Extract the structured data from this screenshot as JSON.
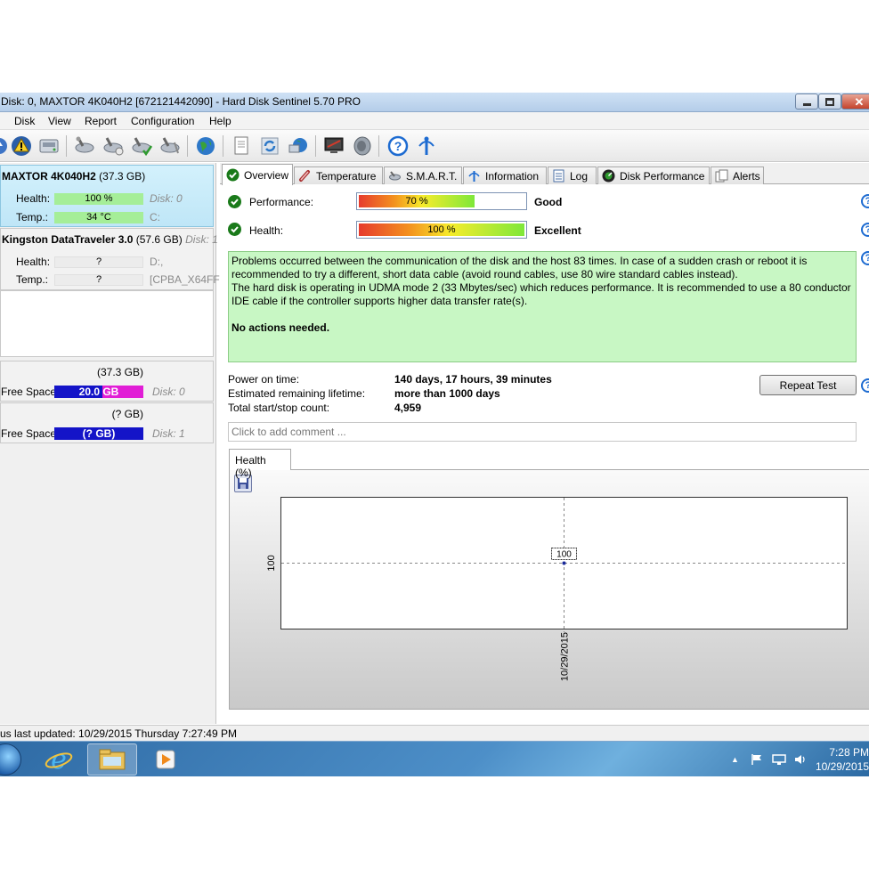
{
  "window": {
    "title": "Disk: 0, MAXTOR 4K040H2 [672121442090]  -  Hard Disk Sentinel 5.70 PRO",
    "close_glyph": "✕"
  },
  "menu": [
    "Disk",
    "View",
    "Report",
    "Configuration",
    "Help"
  ],
  "toolbar": {
    "icons": [
      "refresh-icon",
      "alert-icon",
      "disk-icon",
      "test-icon",
      "test2-icon",
      "test3-icon",
      "test4-icon",
      "web-icon",
      "report-icon",
      "sync-icon",
      "network-icon",
      "monitor-icon",
      "sound-icon",
      "help-icon",
      "info-icon"
    ]
  },
  "disks": [
    {
      "name": "MAXTOR 4K040H2",
      "size": "(37.3 GB)",
      "disk_no": "",
      "health_label": "Health:",
      "health": "100 %",
      "health_meta": "Disk: 0",
      "temp_label": "Temp.:",
      "temp": "34 °C",
      "temp_meta": "C:"
    },
    {
      "name": "Kingston DataTraveler 3.0",
      "size": "(57.6 GB)",
      "disk_no": "Disk: 1",
      "health_label": "Health:",
      "health": "?",
      "health_meta": "D:,",
      "temp_label": "Temp.:",
      "temp": "?",
      "temp_meta": "[CPBA_X64FF"
    }
  ],
  "volumes": [
    {
      "size": "(37.3 GB)",
      "label": "Free Space",
      "free": "20.0 GB",
      "used_fraction": 0.46,
      "disk": "Disk: 0"
    },
    {
      "size": "(? GB)",
      "label": "Free Space",
      "free": "(? GB)",
      "used_fraction": 0,
      "disk": "Disk: 1"
    }
  ],
  "tabs": [
    "Overview",
    "Temperature",
    "S.M.A.R.T.",
    "Information",
    "Log",
    "Disk Performance",
    "Alerts"
  ],
  "overview": {
    "performance_label": "Performance:",
    "performance_value": "70 %",
    "performance_fraction": 0.7,
    "performance_word": "Good",
    "health_label": "Health:",
    "health_value": "100 %",
    "health_fraction": 1.0,
    "health_word": "Excellent",
    "help_glyph": "?",
    "message_p1": "Problems occurred between the communication of the disk and the host 83 times. In case of a sudden crash or reboot it is recommended to try a different, short data cable (avoid round cables, use 80 wire standard cables instead).",
    "message_p2": "The hard disk is operating in UDMA mode 2 (33 Mbytes/sec) which reduces performance. It is recommended to use a 80 conductor IDE cable if the controller supports higher data transfer rate(s).",
    "message_bold": "No actions needed.",
    "power_on_label": "Power on time:",
    "power_on_value": "140 days, 17 hours, 39 minutes",
    "lifetime_label": "Estimated remaining lifetime:",
    "lifetime_value": "more than 1000 days",
    "startstop_label": "Total start/stop count:",
    "startstop_value": "4,959",
    "repeat_button": "Repeat Test",
    "comment_placeholder": "Click to add comment ..."
  },
  "chart_tab": "Health (%)",
  "chart_data": {
    "type": "line",
    "x": [
      "10/29/2015"
    ],
    "series": [
      {
        "values": [
          100
        ]
      }
    ],
    "ytick": "100",
    "xtick": "10/29/2015",
    "point_label": "100",
    "grid": true
  },
  "status": "us last updated: 10/29/2015 Thursday 7:27:49 PM",
  "taskbar": {
    "time": "7:28 PM",
    "date": "10/29/2015",
    "tray_arrow": "▲"
  }
}
